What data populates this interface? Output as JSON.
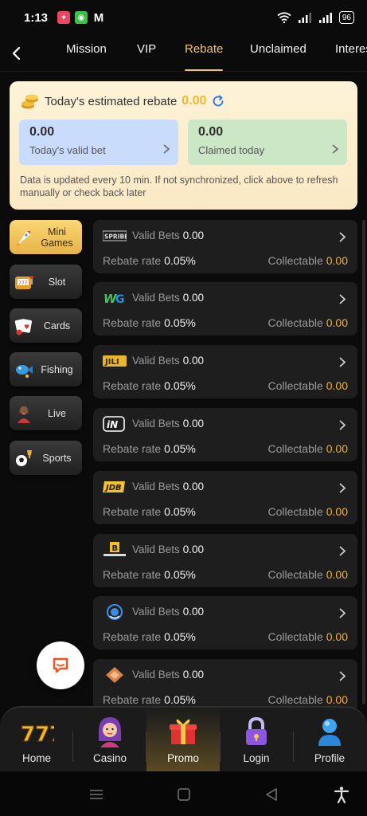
{
  "status_bar": {
    "time": "1:13",
    "battery": "96"
  },
  "tabs": [
    "Mission",
    "VIP",
    "Rebate",
    "Unclaimed",
    "Interest"
  ],
  "active_tab": "Rebate",
  "summary": {
    "title": "Today's estimated rebate",
    "amount": "0.00",
    "valid_bet_value": "0.00",
    "valid_bet_label": "Today's valid bet",
    "claimed_value": "0.00",
    "claimed_label": "Claimed today",
    "note": "Data is updated every 10 min. If not synchronized, click above to refresh manually or check back later"
  },
  "categories": [
    {
      "label": "Mini Games",
      "icon": "rocket-icon",
      "active": true
    },
    {
      "label": "Slot",
      "icon": "slot-machine-icon",
      "active": false
    },
    {
      "label": "Cards",
      "icon": "cards-icon",
      "active": false
    },
    {
      "label": "Fishing",
      "icon": "fish-icon",
      "active": false
    },
    {
      "label": "Live",
      "icon": "live-dealer-icon",
      "active": false
    },
    {
      "label": "Sports",
      "icon": "soccer-ball-icon",
      "active": false
    }
  ],
  "providers": [
    {
      "logo": "spribe-logo",
      "valid_bets_label": "Valid Bets",
      "valid_bets": "0.00",
      "rate_label": "Rebate rate",
      "rate": "0.05%",
      "collectable_label": "Collectable",
      "collectable": "0.00"
    },
    {
      "logo": "wg-logo",
      "valid_bets_label": "Valid Bets",
      "valid_bets": "0.00",
      "rate_label": "Rebate rate",
      "rate": "0.05%",
      "collectable_label": "Collectable",
      "collectable": "0.00"
    },
    {
      "logo": "jili-logo",
      "valid_bets_label": "Valid Bets",
      "valid_bets": "0.00",
      "rate_label": "Rebate rate",
      "rate": "0.05%",
      "collectable_label": "Collectable",
      "collectable": "0.00"
    },
    {
      "logo": "in-logo",
      "valid_bets_label": "Valid Bets",
      "valid_bets": "0.00",
      "rate_label": "Rebate rate",
      "rate": "0.05%",
      "collectable_label": "Collectable",
      "collectable": "0.00"
    },
    {
      "logo": "jdb-logo",
      "valid_bets_label": "Valid Bets",
      "valid_bets": "0.00",
      "rate_label": "Rebate rate",
      "rate": "0.05%",
      "collectable_label": "Collectable",
      "collectable": "0.00"
    },
    {
      "logo": "b-logo",
      "valid_bets_label": "Valid Bets",
      "valid_bets": "0.00",
      "rate_label": "Rebate rate",
      "rate": "0.05%",
      "collectable_label": "Collectable",
      "collectable": "0.00"
    },
    {
      "logo": "blue-circle-logo",
      "valid_bets_label": "Valid Bets",
      "valid_bets": "0.00",
      "rate_label": "Rebate rate",
      "rate": "0.05%",
      "collectable_label": "Collectable",
      "collectable": "0.00"
    },
    {
      "logo": "diamond-logo",
      "valid_bets_label": "Valid Bets",
      "valid_bets": "0.00",
      "rate_label": "Rebate rate",
      "rate": "0.05%",
      "collectable_label": "Collectable",
      "collectable": "0.00"
    }
  ],
  "bottom_nav": [
    {
      "label": "Home",
      "icon": "triple-seven-icon",
      "active": false
    },
    {
      "label": "Casino",
      "icon": "casino-girl-icon",
      "active": false
    },
    {
      "label": "Promo",
      "icon": "gift-icon",
      "active": true
    },
    {
      "label": "Login",
      "icon": "lock-icon",
      "active": false
    },
    {
      "label": "Profile",
      "icon": "profile-icon",
      "active": false
    }
  ],
  "colors": {
    "accent": "#f3c56b",
    "collectable": "#f1b12f",
    "card_bg": "#1e1e1e"
  }
}
